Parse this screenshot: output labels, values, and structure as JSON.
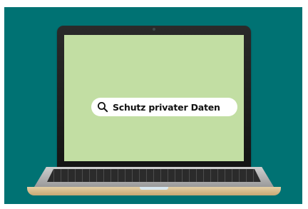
{
  "search": {
    "query": "Schutz privater Daten",
    "icon": "search-icon"
  },
  "colors": {
    "background": "#007273",
    "screen": "#c2dea3",
    "search_pill": "#ffffff",
    "laptop_bezel": "#1e1e1e",
    "laptop_body": "#b5b5b5"
  }
}
